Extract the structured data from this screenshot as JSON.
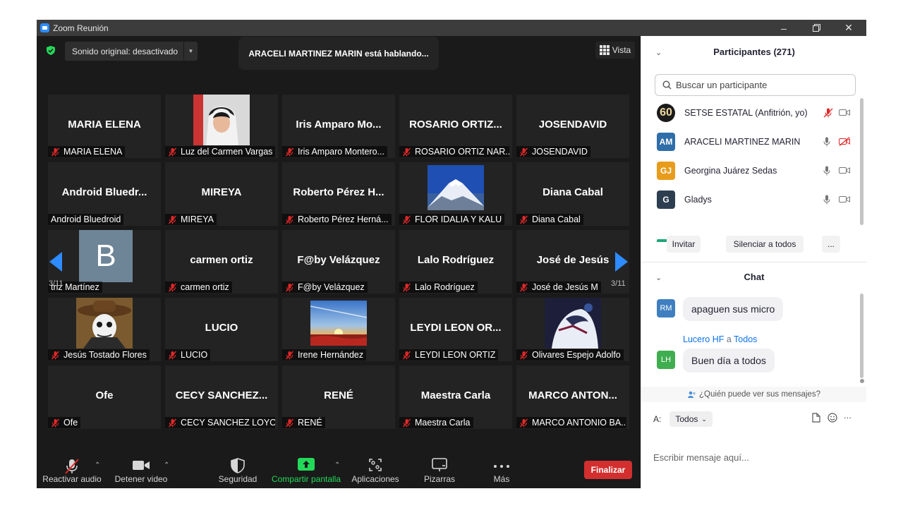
{
  "window": {
    "title": "Zoom Reunión"
  },
  "meeting": {
    "sound_label": "Sonido original: desactivado",
    "speaking_banner": "ARACELI MARTINEZ MARIN está hablando...",
    "view_label": "Vista",
    "page_left": "3/11",
    "page_right": "3/11"
  },
  "tiles": [
    {
      "big": "MARIA ELENA",
      "foot": "MARIA ELENA",
      "muted": true
    },
    {
      "big": "",
      "foot": "Luz del Carmen Vargas",
      "muted": true,
      "photo": "hoodie-selfie"
    },
    {
      "big": "Iris Amparo Mo...",
      "foot": "Iris Amparo Montero...",
      "muted": true
    },
    {
      "big": "ROSARIO  ORTIZ...",
      "foot": "ROSARIO ORTIZ NAR...",
      "muted": true
    },
    {
      "big": "JOSENDAVID",
      "foot": "JOSENDAVID",
      "muted": true
    },
    {
      "big": "Android  Bluedr...",
      "foot": "Android Bluedroid",
      "muted": false
    },
    {
      "big": "MIREYA",
      "foot": "MIREYA",
      "muted": true
    },
    {
      "big": "Roberto  Pérez  H...",
      "foot": "Roberto Pérez Herná...",
      "muted": true
    },
    {
      "big": "",
      "foot": "FLOR IDALIA  Y KALU",
      "muted": true,
      "photo": "snowy-volcano"
    },
    {
      "big": "Diana Cabal",
      "foot": "Diana Cabal",
      "muted": true
    },
    {
      "big": "",
      "foot": "triz Martínez",
      "muted": false,
      "avatar_letter": "B"
    },
    {
      "big": "carmen ortiz",
      "foot": "carmen ortiz",
      "muted": true
    },
    {
      "big": "F@by Velázquez",
      "foot": "F@by Velázquez",
      "muted": true
    },
    {
      "big": "Lalo Rodríguez",
      "foot": "Lalo Rodríguez",
      "muted": true
    },
    {
      "big": "José de Jesús",
      "foot": "José de Jesús M",
      "muted": true
    },
    {
      "big": "",
      "foot": "Jesús Tostado Flores",
      "muted": true,
      "photo": "cowboy-cartoon"
    },
    {
      "big": "LUCIO",
      "foot": "LUCIO",
      "muted": true
    },
    {
      "big": "",
      "foot": "Irene Hernández",
      "muted": true,
      "photo": "sunset-field"
    },
    {
      "big": "LEYDI LEON OR...",
      "foot": "LEYDI LEON ORTIZ",
      "muted": true
    },
    {
      "big": "",
      "foot": "Olivares Espejo Adolfo",
      "muted": true,
      "photo": "anime-art"
    },
    {
      "big": "Ofe",
      "foot": "Ofe",
      "muted": true
    },
    {
      "big": "CECY  SANCHEZ...",
      "foot": "CECY SANCHEZ LOYO",
      "muted": true
    },
    {
      "big": "RENÉ",
      "foot": "RENÉ",
      "muted": true
    },
    {
      "big": "Maestra Carla",
      "foot": "Maestra Carla",
      "muted": true
    },
    {
      "big": "MARCO  ANTON...",
      "foot": "MARCO ANTONIO BA...",
      "muted": true
    }
  ],
  "toolbar": {
    "audio": "Reactivar audio",
    "video": "Detener video",
    "security": "Seguridad",
    "share": "Compartir pantalla",
    "apps": "Aplicaciones",
    "whiteboards": "Pizarras",
    "more": "Más",
    "end": "Finalizar"
  },
  "participants": {
    "header": "Participantes (271)",
    "search_placeholder": "Buscar un participante",
    "list": [
      {
        "initials": "60",
        "name": "SETSE ESTATAL (Anfitrión, yo)",
        "color": "#1b1b1b"
      },
      {
        "initials": "AM",
        "name": "ARACELI MARTINEZ MARIN",
        "color": "#2f6ea8"
      },
      {
        "initials": "GJ",
        "name": "Georgina Juárez Sedas",
        "color": "#e89c1c"
      },
      {
        "initials": "G",
        "name": "Gladys",
        "color": "#2d3e50"
      }
    ],
    "invite": "Invitar",
    "mute_all": "Silenciar a todos",
    "more": "..."
  },
  "chat": {
    "header": "Chat",
    "messages": [
      {
        "initials": "RM",
        "text": "apaguen sus micro",
        "color": "#3f7fbf"
      },
      {
        "initials": "LH",
        "sender": "Lucero HF",
        "to_word": "a",
        "recipient": "Todos",
        "text": "Buen día a todos",
        "color": "#3fae4f"
      }
    ],
    "who_can_see": "¿Quién puede ver sus mensajes?",
    "to_label": "A:",
    "to_value": "Todos",
    "composer_placeholder": "Escribir mensaje aquí...",
    "more": "..."
  },
  "colors": {
    "accent": "#2d8cff",
    "share_green": "#23d959",
    "end_red": "#d32f2f",
    "muted_red": "#e02828"
  }
}
